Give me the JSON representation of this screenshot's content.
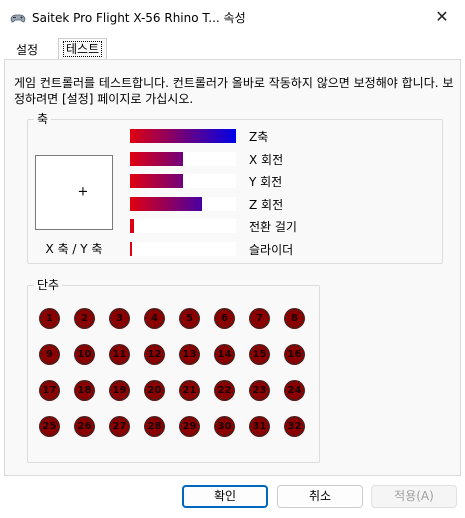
{
  "window": {
    "title": "Saitek Pro Flight X-56 Rhino T... 속성",
    "close_glyph": "✕",
    "icon": "joystick-icon"
  },
  "tabs": [
    {
      "label": "설정",
      "active": false
    },
    {
      "label": "테스트",
      "active": true
    }
  ],
  "info_text": "게임 컨트롤러를 테스트합니다. 컨트롤러가 올바로 작동하지 않으면 보정해야 합니다. 보정하려면 [설정] 페이지로 가십시오.",
  "axes_group": {
    "label": "축",
    "xy_label": "X 축 / Y 축",
    "crosshair": "+",
    "axes": [
      {
        "label": "Z축",
        "level": 1.0
      },
      {
        "label": "X 회전",
        "level": 0.5
      },
      {
        "label": "Y 회전",
        "level": 0.5
      },
      {
        "label": "Z 회전",
        "level": 0.68
      },
      {
        "label": "전환 걸기",
        "level": 0.04
      },
      {
        "label": "슬라이더",
        "level": 0.01
      }
    ]
  },
  "buttons_group": {
    "label": "단추",
    "buttons": [
      "1",
      "2",
      "3",
      "4",
      "5",
      "6",
      "7",
      "8",
      "9",
      "10",
      "11",
      "12",
      "13",
      "14",
      "15",
      "16",
      "17",
      "18",
      "19",
      "20",
      "21",
      "22",
      "23",
      "24",
      "25",
      "26",
      "27",
      "28",
      "29",
      "30",
      "31",
      "32"
    ]
  },
  "footer": {
    "ok": "확인",
    "cancel": "취소",
    "apply": "적용(A)"
  },
  "colors": {
    "axis_start": "#e00010",
    "axis_end": "#0000e8",
    "button_off": "#8b0000",
    "focus_border": "#0067c0"
  }
}
